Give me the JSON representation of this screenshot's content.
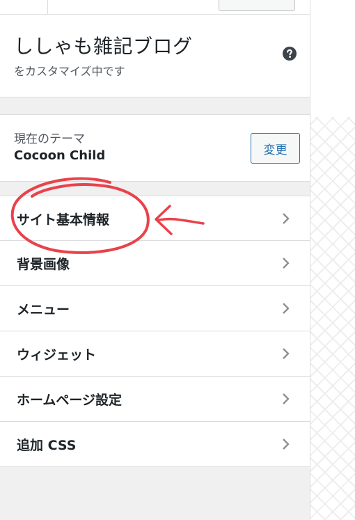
{
  "header": {
    "site_title": "ししゃも雑記ブログ",
    "subtitle": "をカスタマイズ中です",
    "help_icon": "question-circle-icon"
  },
  "theme": {
    "label": "現在のテーマ",
    "name": "Cocoon Child",
    "change_label": "変更"
  },
  "menu": {
    "items": [
      {
        "label": "サイト基本情報"
      },
      {
        "label": "背景画像"
      },
      {
        "label": "メニュー"
      },
      {
        "label": "ウィジェット"
      },
      {
        "label": "ホームページ設定"
      },
      {
        "label": "追加 CSS"
      }
    ],
    "chevron_icon": "chevron-right-icon"
  },
  "colors": {
    "accent": "#2271b1",
    "annotation": "#e8424a",
    "panel_bg": "#f0f0f1",
    "divider": "#dcdcde"
  }
}
